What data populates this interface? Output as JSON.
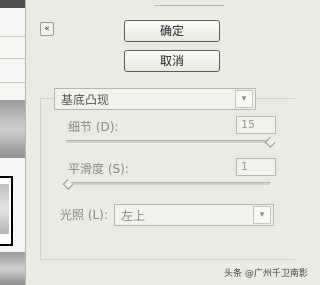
{
  "dialog": {
    "title_fragment": "确定",
    "buttons": {
      "ok_label": "确定",
      "cancel_label": "取消"
    },
    "collapse_glyph": "«"
  },
  "filter": {
    "selected": "基底凸现",
    "dropdown_glyph": "▾"
  },
  "params": {
    "detail": {
      "label": "细节 (D):",
      "value": "15",
      "fraction": 1.0
    },
    "smoothness": {
      "label": "平滑度 (S):",
      "value": "1",
      "fraction": 0.0
    },
    "light": {
      "label": "光照 (L):",
      "selected": "左上"
    }
  },
  "watermark": "头条 @广州千卫南影"
}
